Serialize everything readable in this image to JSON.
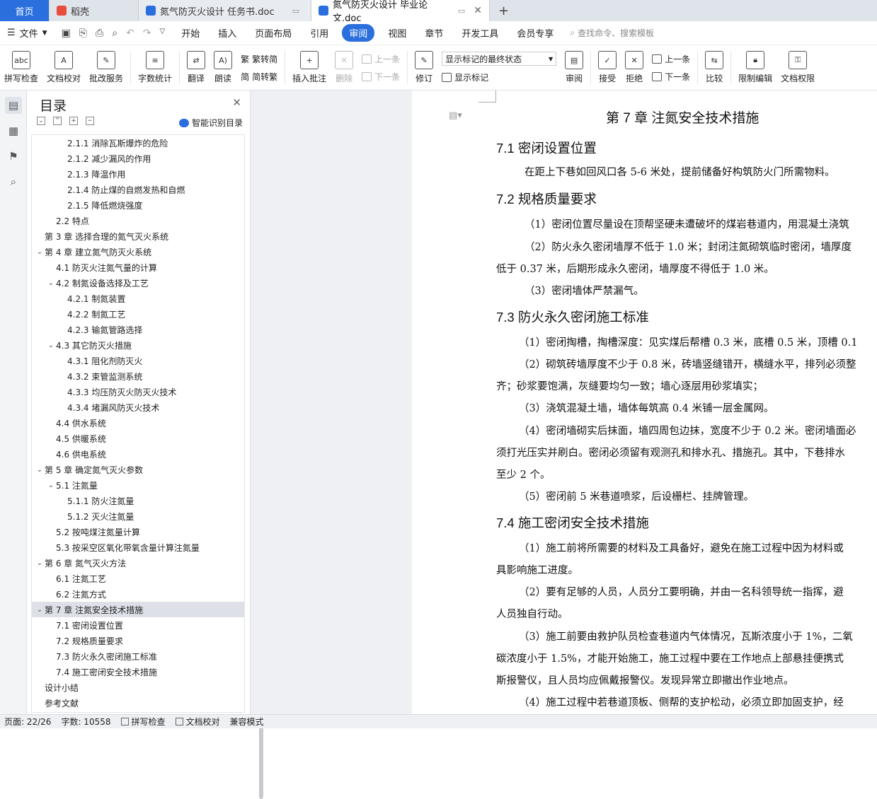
{
  "tabs": [
    {
      "label": "首页"
    },
    {
      "label": "稻壳"
    },
    {
      "label": "氮气防灭火设计 任务书.doc"
    },
    {
      "label": "氮气防灭火设计 毕业论文.doc"
    }
  ],
  "menu": {
    "file": "文件",
    "items": [
      "开始",
      "插入",
      "页面布局",
      "引用",
      "审阅",
      "视图",
      "章节",
      "开发工具",
      "会员专享"
    ],
    "search": "查找命令、搜索模板"
  },
  "ribbon": {
    "spell_check": "拼写检查",
    "doc_proof": "文档校对",
    "annotation_service": "批改服务",
    "word_count": "字数统计",
    "translate": "翻译",
    "read_aloud": "朗读",
    "trad_simp": "繁转简",
    "simp_trad": "简转繁",
    "insert_comment": "插入批注",
    "delete": "删除",
    "prev": "上一条",
    "next": "下一条",
    "track": "修订",
    "markup_select": "显示标记的最终状态",
    "show_markup": "显示标记",
    "review": "审阅",
    "accept": "接受",
    "reject": "拒绝",
    "prev2": "上一条",
    "next2": "下一条",
    "compare": "比较",
    "restrict": "限制编辑",
    "permission": "文档权限",
    "abc": "abc"
  },
  "toc": {
    "title": "目录",
    "smart": "智能识别目录",
    "items": [
      {
        "label": "2.1.1 消除瓦斯爆炸的危险",
        "level": 3
      },
      {
        "label": "2.1.2 减少漏风的作用",
        "level": 3
      },
      {
        "label": "2.1.3 降温作用",
        "level": 3
      },
      {
        "label": "2.1.4 防止煤的自燃发热和自燃",
        "level": 3
      },
      {
        "label": "2.1.5 降低燃烧强度",
        "level": 3
      },
      {
        "label": "2.2 特点",
        "level": 2
      },
      {
        "label": "第 3 章 选择合理的氮气灭火系统",
        "level": 1
      },
      {
        "label": "第 4 章 建立氮气防灭火系统",
        "level": 1,
        "arrow": true
      },
      {
        "label": "4.1 防灭火注氮气量的计算",
        "level": 2
      },
      {
        "label": "4.2 制氮设备选择及工艺",
        "level": 2,
        "arrow": true
      },
      {
        "label": "4.2.1 制氮装置",
        "level": 3
      },
      {
        "label": "4.2.2 制氮工艺",
        "level": 3
      },
      {
        "label": "4.2.3 输氮管路选择",
        "level": 3
      },
      {
        "label": "4.3 其它防灭火措施",
        "level": 2,
        "arrow": true
      },
      {
        "label": "4.3.1 阻化剂防灭火",
        "level": 3
      },
      {
        "label": "4.3.2 束管监测系统",
        "level": 3
      },
      {
        "label": "4.3.3 均压防灭火防灭火技术",
        "level": 3
      },
      {
        "label": "4.3.4 堵漏风防灭火技术",
        "level": 3
      },
      {
        "label": "4.4 供水系统",
        "level": 2
      },
      {
        "label": "4.5 供暖系统",
        "level": 2
      },
      {
        "label": "4.6 供电系统",
        "level": 2
      },
      {
        "label": "第 5 章 确定氮气灭火参数",
        "level": 1,
        "arrow": true
      },
      {
        "label": "5.1 注氮量",
        "level": 2,
        "arrow": true
      },
      {
        "label": "5.1.1 防火注氮量",
        "level": 3
      },
      {
        "label": "5.1.2 灭火注氮量",
        "level": 3
      },
      {
        "label": "5.2 按吨煤注氮量计算",
        "level": 2
      },
      {
        "label": "5.3 按采空区氧化带氧含量计算注氮量",
        "level": 2
      },
      {
        "label": "第 6 章 氮气灭火方法",
        "level": 1,
        "arrow": true
      },
      {
        "label": "6.1 注氮工艺",
        "level": 2
      },
      {
        "label": "6.2 注氮方式",
        "level": 2
      },
      {
        "label": "第 7 章 注氮安全技术措施",
        "level": 1,
        "arrow": true,
        "selected": true
      },
      {
        "label": "7.1 密闭设置位置",
        "level": 2
      },
      {
        "label": "7.2 规格质量要求",
        "level": 2
      },
      {
        "label": "7.3 防火永久密闭施工标准",
        "level": 2
      },
      {
        "label": "7.4 施工密闭安全技术措施",
        "level": 2
      },
      {
        "label": "设计小结",
        "level": 1
      },
      {
        "label": "参考文献",
        "level": 1
      }
    ]
  },
  "doc": {
    "chapter": "第 7 章 注氮安全技术措施",
    "s71": "7.1 密闭设置位置",
    "p71": "在距上下巷如回风口各 5-6 米处，提前储备好构筑防火门所需物料。",
    "s72": "7.2 规格质量要求",
    "p72a": "（1）密闭位置尽量设在顶帮坚硬未遭破坏的煤岩巷道内，用混凝土浇筑",
    "p72b1": "（2）防火永久密闭墙厚不低于 1.0 米；封闭注氮砌筑临时密闭，墙厚度",
    "p72b2": "低于 0.37 米，后期形成永久密闭，墙厚度不得低于 1.0 米。",
    "p72c": "（3）密闭墙体严禁漏气。",
    "s73": "7.3 防火永久密闭施工标准",
    "p73a": "（1）密闭掏槽，掏槽深度：见实煤后帮槽 0.3 米，底槽 0.5 米，顶槽 0.1",
    "p73b1": "（2）砌筑砖墙厚度不少于 0.8 米，砖墙竖缝错开，横缝水平，排列必须整",
    "p73b2": "齐；砂浆要饱满，灰缝要均匀一致；墙心逐层用砂浆填实；",
    "p73c": "（3）浇筑混凝土墙，墙体每筑高 0.4 米铺一层金属网。",
    "p73d1": "（4）密闭墙砌实后抹面，墙四周包边抹，宽度不少于 0.2  米。密闭墙面必",
    "p73d2": "须打光压实并刷白。密闭必须留有观测孔和排水孔、措施孔。其中，下巷排水",
    "p73d3": "至少 2 个。",
    "p73e": "（5）密闭前 5  米巷道喷浆，后设栅栏、挂牌管理。",
    "s74": "7.4 施工密闭安全技术措施",
    "p74a1": "（1）施工前将所需要的材料及工具备好，避免在施工过程中因为材料或",
    "p74a2": "具影响施工进度。",
    "p74b1": "（2）要有足够的人员，人员分工要明确，并由一名科领导统一指挥，避",
    "p74b2": "人员独自行动。",
    "p74c1": "（3）施工前要由救护队员检查巷道内气体情况，瓦斯浓度小于 1%，二氧",
    "p74c2": "碳浓度小于 1.5%，才能开始施工，施工过程中要在工作地点上部悬挂便携式",
    "p74c3": "斯报警仪，且人员均应佩戴报警仪。发现异常立即撤出作业地点。",
    "p74d1": "（4）施工过程中若巷道顶板、侧帮的支护松动，必须立即加固支护，经"
  },
  "status": {
    "page": "页面: 22/26",
    "words": "字数: 10558",
    "spell": "拼写检查",
    "proof": "文档校对",
    "compat": "兼容模式"
  },
  "colors": {
    "accent": "#2b6fde",
    "selected": "#dde1e7"
  }
}
